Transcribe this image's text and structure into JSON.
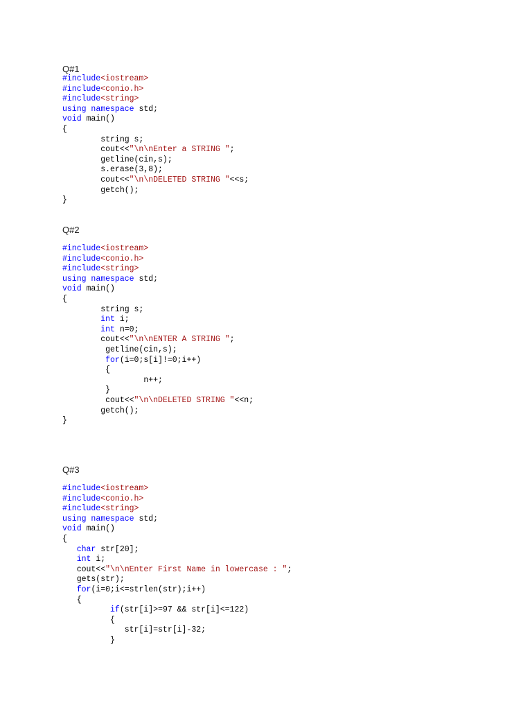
{
  "document": {
    "sections": [
      {
        "heading": "Q#1",
        "lines": [
          [
            {
              "t": "#include",
              "c": "pre"
            },
            {
              "t": "<iostream>",
              "c": "str"
            }
          ],
          [
            {
              "t": "#include",
              "c": "pre"
            },
            {
              "t": "<conio.h>",
              "c": "str"
            }
          ],
          [
            {
              "t": "#include",
              "c": "pre"
            },
            {
              "t": "<string>",
              "c": "str"
            }
          ],
          [
            {
              "t": "using",
              "c": "kw"
            },
            {
              "t": " "
            },
            {
              "t": "namespace",
              "c": "kw"
            },
            {
              "t": " std;"
            }
          ],
          [
            {
              "t": "void",
              "c": "kw"
            },
            {
              "t": " main()"
            }
          ],
          [
            {
              "t": "{"
            }
          ],
          [
            {
              "t": "        string s;"
            }
          ],
          [
            {
              "t": "        cout<<"
            },
            {
              "t": "\"\\n\\nEnter a STRING \"",
              "c": "str"
            },
            {
              "t": ";"
            }
          ],
          [
            {
              "t": "        getline(cin,s);"
            }
          ],
          [
            {
              "t": "        s.erase(3,8);"
            }
          ],
          [
            {
              "t": "        cout<<"
            },
            {
              "t": "\"\\n\\nDELETED STRING \"",
              "c": "str"
            },
            {
              "t": "<<s;"
            }
          ],
          [
            {
              "t": "        getch();"
            }
          ],
          [
            {
              "t": "}"
            }
          ]
        ]
      },
      {
        "heading": "Q#2",
        "lines": [
          [
            {
              "t": "#include",
              "c": "pre"
            },
            {
              "t": "<iostream>",
              "c": "str"
            }
          ],
          [
            {
              "t": "#include",
              "c": "pre"
            },
            {
              "t": "<conio.h>",
              "c": "str"
            }
          ],
          [
            {
              "t": "#include",
              "c": "pre"
            },
            {
              "t": "<string>",
              "c": "str"
            }
          ],
          [
            {
              "t": "using",
              "c": "kw"
            },
            {
              "t": " "
            },
            {
              "t": "namespace",
              "c": "kw"
            },
            {
              "t": " std;"
            }
          ],
          [
            {
              "t": "void",
              "c": "kw"
            },
            {
              "t": " main()"
            }
          ],
          [
            {
              "t": "{"
            }
          ],
          [
            {
              "t": "        string s;"
            }
          ],
          [
            {
              "t": "        "
            },
            {
              "t": "int",
              "c": "kw"
            },
            {
              "t": " i;"
            }
          ],
          [
            {
              "t": "        "
            },
            {
              "t": "int",
              "c": "kw"
            },
            {
              "t": " n=0;"
            }
          ],
          [
            {
              "t": "        cout<<"
            },
            {
              "t": "\"\\n\\nENTER A STRING \"",
              "c": "str"
            },
            {
              "t": ";"
            }
          ],
          [
            {
              "t": "         getline(cin,s);"
            }
          ],
          [
            {
              "t": "         "
            },
            {
              "t": "for",
              "c": "kw"
            },
            {
              "t": "(i=0;s[i]!=0;i++)"
            }
          ],
          [
            {
              "t": "         {"
            }
          ],
          [
            {
              "t": "                 n++;"
            }
          ],
          [
            {
              "t": "         }"
            }
          ],
          [
            {
              "t": "         cout<<"
            },
            {
              "t": "\"\\n\\nDELETED STRING \"",
              "c": "str"
            },
            {
              "t": "<<n;"
            }
          ],
          [
            {
              "t": "        getch();"
            }
          ],
          [
            {
              "t": "}"
            }
          ]
        ]
      },
      {
        "heading": "Q#3",
        "lines": [
          [
            {
              "t": "#include",
              "c": "pre"
            },
            {
              "t": "<iostream>",
              "c": "str"
            }
          ],
          [
            {
              "t": "#include",
              "c": "pre"
            },
            {
              "t": "<conio.h>",
              "c": "str"
            }
          ],
          [
            {
              "t": "#include",
              "c": "pre"
            },
            {
              "t": "<string>",
              "c": "str"
            }
          ],
          [
            {
              "t": "using",
              "c": "kw"
            },
            {
              "t": " "
            },
            {
              "t": "namespace",
              "c": "kw"
            },
            {
              "t": " std;"
            }
          ],
          [
            {
              "t": "void",
              "c": "kw"
            },
            {
              "t": " main()"
            }
          ],
          [
            {
              "t": "{"
            }
          ],
          [
            {
              "t": "   "
            },
            {
              "t": "char",
              "c": "kw"
            },
            {
              "t": " str[20];"
            }
          ],
          [
            {
              "t": "   "
            },
            {
              "t": "int",
              "c": "kw"
            },
            {
              "t": " i;"
            }
          ],
          [
            {
              "t": "   cout<<"
            },
            {
              "t": "\"\\n\\nEnter First Name in lowercase : \"",
              "c": "str"
            },
            {
              "t": ";"
            }
          ],
          [
            {
              "t": "   gets(str);"
            }
          ],
          [
            {
              "t": "   "
            },
            {
              "t": "for",
              "c": "kw"
            },
            {
              "t": "(i=0;i<=strlen(str);i++)"
            }
          ],
          [
            {
              "t": "   {"
            }
          ],
          [
            {
              "t": "          "
            },
            {
              "t": "if",
              "c": "kw"
            },
            {
              "t": "(str[i]>=97 && str[i]<=122)"
            }
          ],
          [
            {
              "t": "          {"
            }
          ],
          [
            {
              "t": "             str[i]=str[i]-32;"
            }
          ],
          [
            {
              "t": "          }"
            }
          ]
        ]
      }
    ]
  }
}
